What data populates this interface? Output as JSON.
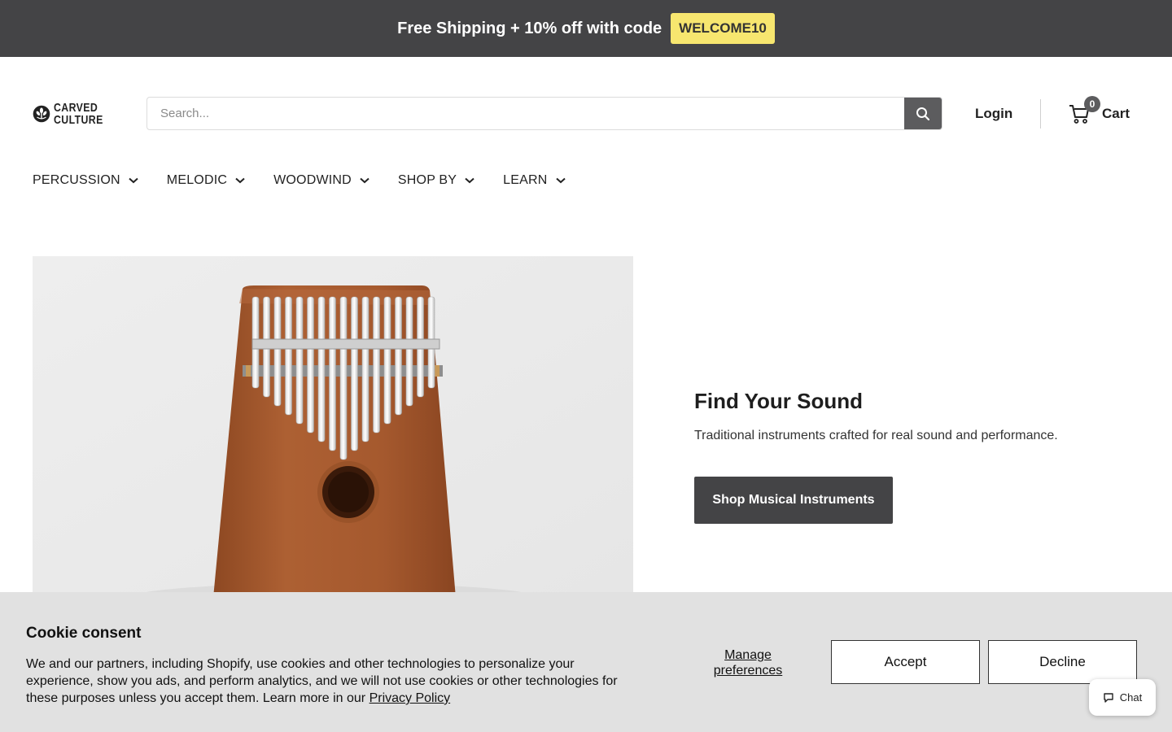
{
  "announcement": {
    "text": "Free Shipping + 10% off with code",
    "code": "WELCOME10"
  },
  "header": {
    "logo": {
      "line1": "CARVED",
      "line2": "CULTURE"
    },
    "search": {
      "placeholder": "Search...",
      "value": ""
    },
    "login_label": "Login",
    "cart": {
      "count": "0",
      "label": "Cart"
    }
  },
  "nav": {
    "items": [
      {
        "label": "PERCUSSION"
      },
      {
        "label": "MELODIC"
      },
      {
        "label": "WOODWIND"
      },
      {
        "label": "SHOP BY"
      },
      {
        "label": "LEARN"
      }
    ]
  },
  "hero": {
    "title": "Find Your Sound",
    "subtitle": "Traditional instruments crafted for real sound and performance.",
    "button_label": "Shop Musical Instruments"
  },
  "cookie": {
    "title": "Cookie consent",
    "body": "We and our partners, including Shopify, use cookies and other technologies to personalize your experience, show you ads, and perform analytics, and we will not use cookies or other technologies for these purposes unless you accept them. Learn more in our",
    "privacy_link": "Privacy Policy",
    "manage_label": "Manage preferences",
    "accept_label": "Accept",
    "decline_label": "Decline"
  },
  "chat": {
    "label": "Chat"
  },
  "colors": {
    "announcement_bg": "#444446",
    "code_badge": "#f7e66f",
    "button_dark": "#444446",
    "cookie_bg": "#e1e1e1",
    "kalimba_wood": "#a5592e"
  }
}
